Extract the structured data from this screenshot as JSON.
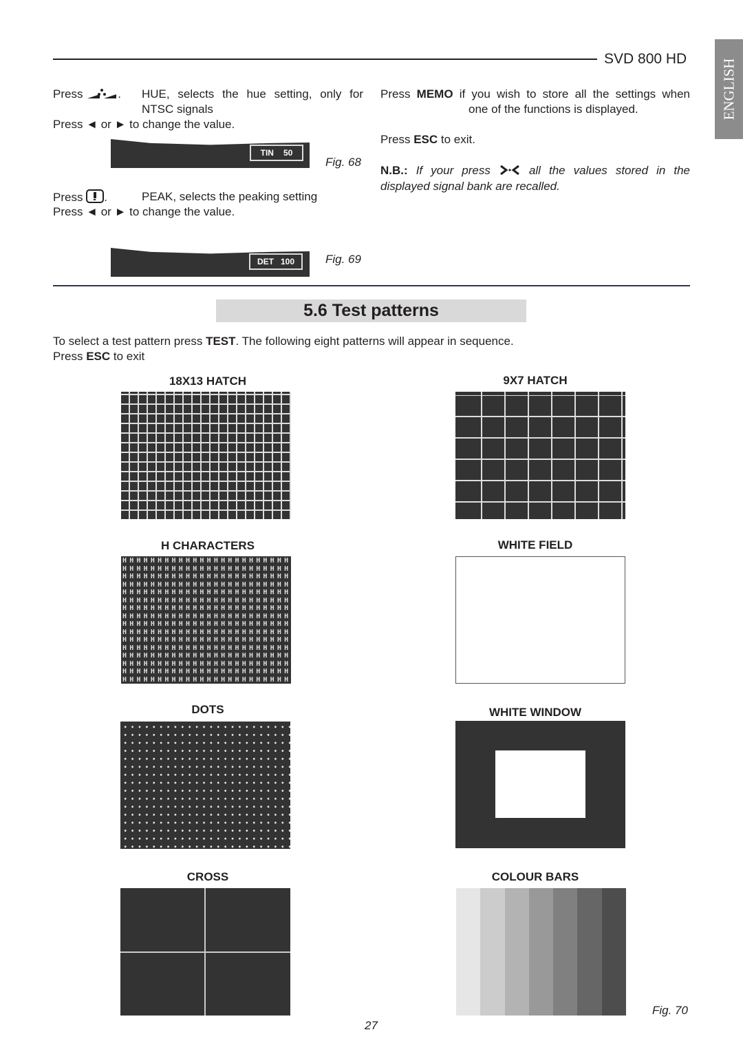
{
  "header": {
    "model": "SVD 800 HD",
    "language_tab": "ENGLISH"
  },
  "left": {
    "hue_press": "Press",
    "hue_icon": "hue-button-icon",
    "hue_desc": "HUE, selects the hue setting, only for",
    "hue_desc2": "NTSC signals",
    "change1": "Press ◄ or ► to change the value.",
    "osd1": {
      "label": "TIN",
      "value": "50"
    },
    "fig68": "Fig. 68",
    "peak_press": "Press",
    "peak_icon": "peak-button-icon",
    "peak_desc": "PEAK, selects the peaking setting",
    "change2": "Press ◄ or ► to change the value.",
    "osd2": {
      "label": "DET",
      "value": "100"
    },
    "fig69": "Fig. 69"
  },
  "right": {
    "memo_pre": "Press ",
    "memo_key": "MEMO",
    "memo_post": " if you wish to store all the settings when",
    "memo_line2": "one of the functions is displayed.",
    "esc_pre": "Press ",
    "esc_key": "ESC",
    "esc_post": " to exit.",
    "nb_label": "N.B.:",
    "nb_text1": " If your press ",
    "nb_icon": "recall-icon",
    "nb_text2": " all the values stored in the",
    "nb_line2": "displayed signal bank are recalled."
  },
  "section": {
    "title": "5.6 Test patterns",
    "intro_pre": "To select a test pattern press ",
    "intro_key": "TEST",
    "intro_post": ". The following eight patterns will appear in sequence.",
    "esc_pre": "Press ",
    "esc_key": "ESC",
    "esc_post": " to exit"
  },
  "patterns": [
    {
      "title": "18X13 HATCH"
    },
    {
      "title": "9X7 HATCH"
    },
    {
      "title": "H CHARACTERS"
    },
    {
      "title": "WHITE FIELD"
    },
    {
      "title": "DOTS"
    },
    {
      "title": "WHITE WINDOW"
    },
    {
      "title": "CROSS"
    },
    {
      "title": "COLOUR BARS",
      "bars": [
        "#e6e6e6",
        "#cccccc",
        "#b3b3b3",
        "#999999",
        "#808080",
        "#666666",
        "#4d4d4d"
      ]
    }
  ],
  "fig70": "Fig. 70",
  "page_number": "27"
}
